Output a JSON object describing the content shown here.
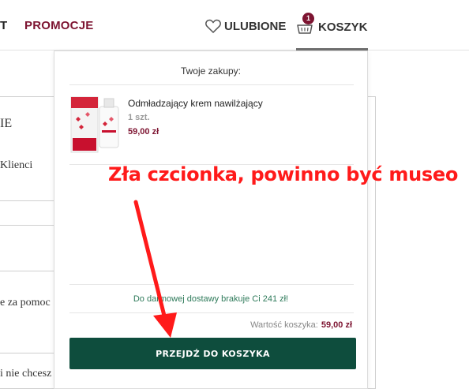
{
  "nav": {
    "cut_label": "T",
    "promo_label": "PROMOCJE",
    "favorites_label": "ULUBIONE",
    "cart_label": "KOSZYK",
    "cart_count": "1",
    "accent_color": "#7d1431"
  },
  "background": {
    "heading_fragment": "IE",
    "clients_fragment": "Klienci",
    "help_fragment": "e za pomoc",
    "dont_want_fragment": "i nie chcesz"
  },
  "dropdown": {
    "title": "Twoje zakupy:",
    "product": {
      "name": "Odmładzający krem nawilżający",
      "quantity": "1 szt.",
      "price": "59,00 zł",
      "image_icon": "cream-product-image"
    },
    "shipping_notice": "Do darmowej dostawy brakuje Ci 241 zł!",
    "total_label": "Wartość koszyka:",
    "total_value": "59,00 zł",
    "checkout_label": "PRZEJDŹ DO KOSZYKA",
    "checkout_color": "#0e4d3d",
    "shipping_color": "#2e7a5a"
  },
  "annotation": {
    "text": "Zła czcionka, powinno być museo",
    "color": "#ff1a1a"
  }
}
